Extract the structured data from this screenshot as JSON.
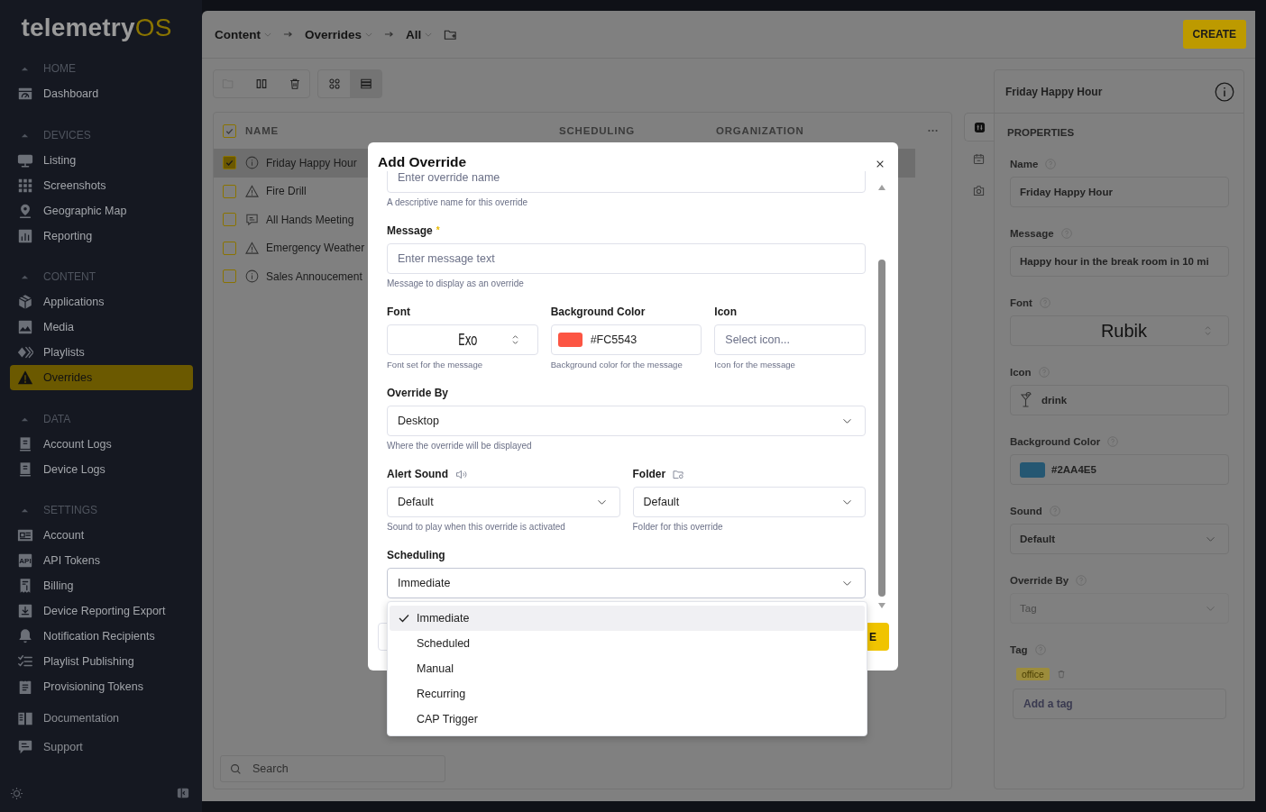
{
  "sidebar": {
    "logo": {
      "text": "telemetry",
      "accent": "OS"
    },
    "sections": [
      {
        "title": "HOME",
        "expanded": true,
        "items": [
          {
            "label": "Dashboard",
            "selected": false
          }
        ]
      },
      {
        "title": "DEVICES",
        "expanded": true,
        "items": [
          {
            "label": "Listing",
            "selected": false
          },
          {
            "label": "Screenshots",
            "selected": false
          },
          {
            "label": "Geographic Map",
            "selected": false
          },
          {
            "label": "Reporting",
            "selected": false
          }
        ]
      },
      {
        "title": "CONTENT",
        "expanded": true,
        "items": [
          {
            "label": "Applications",
            "selected": false
          },
          {
            "label": "Media",
            "selected": false
          },
          {
            "label": "Playlists",
            "selected": false
          },
          {
            "label": "Overrides",
            "selected": true
          }
        ]
      },
      {
        "title": "DATA",
        "expanded": true,
        "items": [
          {
            "label": "Account Logs",
            "selected": false
          },
          {
            "label": "Device Logs",
            "selected": false
          }
        ]
      },
      {
        "title": "SETTINGS",
        "expanded": true,
        "items": [
          {
            "label": "Account",
            "selected": false
          },
          {
            "label": "API Tokens",
            "selected": false,
            "icon_text": "API"
          },
          {
            "label": "Billing",
            "selected": false
          },
          {
            "label": "Device Reporting Export",
            "selected": false
          },
          {
            "label": "Notification Recipients",
            "selected": false
          },
          {
            "label": "Playlist Publishing",
            "selected": false
          },
          {
            "label": "Provisioning Tokens",
            "selected": false
          }
        ]
      }
    ],
    "links": [
      {
        "label": "Documentation"
      },
      {
        "label": "Support"
      }
    ]
  },
  "breadcrumb": [
    {
      "label": "Content"
    },
    {
      "label": "Overrides"
    },
    {
      "label": "All"
    }
  ],
  "create_button": "CREATE",
  "view_modes": [
    {
      "selected": false
    },
    {
      "selected": true
    }
  ],
  "table": {
    "header_checked": true,
    "columns": [
      "NAME",
      "SCHEDULING",
      "ORGANIZATION"
    ],
    "rows": [
      {
        "name": "Friday Happy Hour",
        "kind": "info",
        "checked": true,
        "selected": true
      },
      {
        "name": "Fire Drill",
        "kind": "warning",
        "checked": false,
        "selected": false
      },
      {
        "name": "All Hands Meeting",
        "kind": "message",
        "checked": false,
        "selected": false
      },
      {
        "name": "Emergency Weather",
        "kind": "warning",
        "checked": false,
        "selected": false
      },
      {
        "name": "Sales Annoucement",
        "kind": "info",
        "checked": false,
        "selected": false
      }
    ]
  },
  "search": {
    "placeholder": "Search"
  },
  "properties": {
    "title": "Friday Happy Hour",
    "tabs": [
      {
        "selected": true
      },
      {
        "selected": false
      },
      {
        "selected": false
      }
    ],
    "heading": "PROPERTIES",
    "fields": [
      {
        "kind": "text",
        "label": "Name",
        "value": "Friday Happy Hour"
      },
      {
        "kind": "text",
        "label": "Message",
        "value": "Happy hour in the break room in 10 mi"
      },
      {
        "kind": "font",
        "label": "Font",
        "value": "Rubik"
      },
      {
        "kind": "icon",
        "label": "Icon",
        "value": "drink"
      },
      {
        "kind": "color",
        "label": "Background Color",
        "value": "#2AA4E5"
      },
      {
        "kind": "select",
        "label": "Sound",
        "value": "Default",
        "disabled": false
      },
      {
        "kind": "select",
        "label": "Override By",
        "value": "Tag",
        "disabled": true
      },
      {
        "kind": "tags",
        "label": "Tag",
        "tags": [
          "office"
        ],
        "placeholder": "Add a tag"
      }
    ]
  },
  "modal": {
    "title": "Add Override",
    "name_field": {
      "placeholder": "Enter override name",
      "hint": "A descriptive name for this override"
    },
    "message_field": {
      "label": "Message",
      "required_mark": "*",
      "placeholder": "Enter message text",
      "hint": "Message to display as an override"
    },
    "font_field": {
      "label": "Font",
      "value": "Exo",
      "hint": "Font set for the message"
    },
    "color_field": {
      "label": "Background Color",
      "value": "#FC5543",
      "hint": "Background color for the message"
    },
    "icon_field": {
      "label": "Icon",
      "placeholder": "Select icon...",
      "hint": "Icon for the message"
    },
    "override_by_field": {
      "label": "Override By",
      "value": "Desktop",
      "hint": "Where the override will be displayed"
    },
    "alert_sound_field": {
      "label": "Alert Sound",
      "value": "Default",
      "hint": "Sound to play when this override is activated"
    },
    "folder_field": {
      "label": "Folder",
      "value": "Default",
      "hint": "Folder for this override"
    },
    "scheduling_field": {
      "label": "Scheduling",
      "value": "Immediate",
      "expanded": true,
      "options": [
        {
          "label": "Immediate",
          "selected": true
        },
        {
          "label": "Scheduled",
          "selected": false
        },
        {
          "label": "Manual",
          "selected": false
        },
        {
          "label": "Recurring",
          "selected": false
        },
        {
          "label": "CAP Trigger",
          "selected": false
        }
      ]
    },
    "submit_button": "E"
  }
}
